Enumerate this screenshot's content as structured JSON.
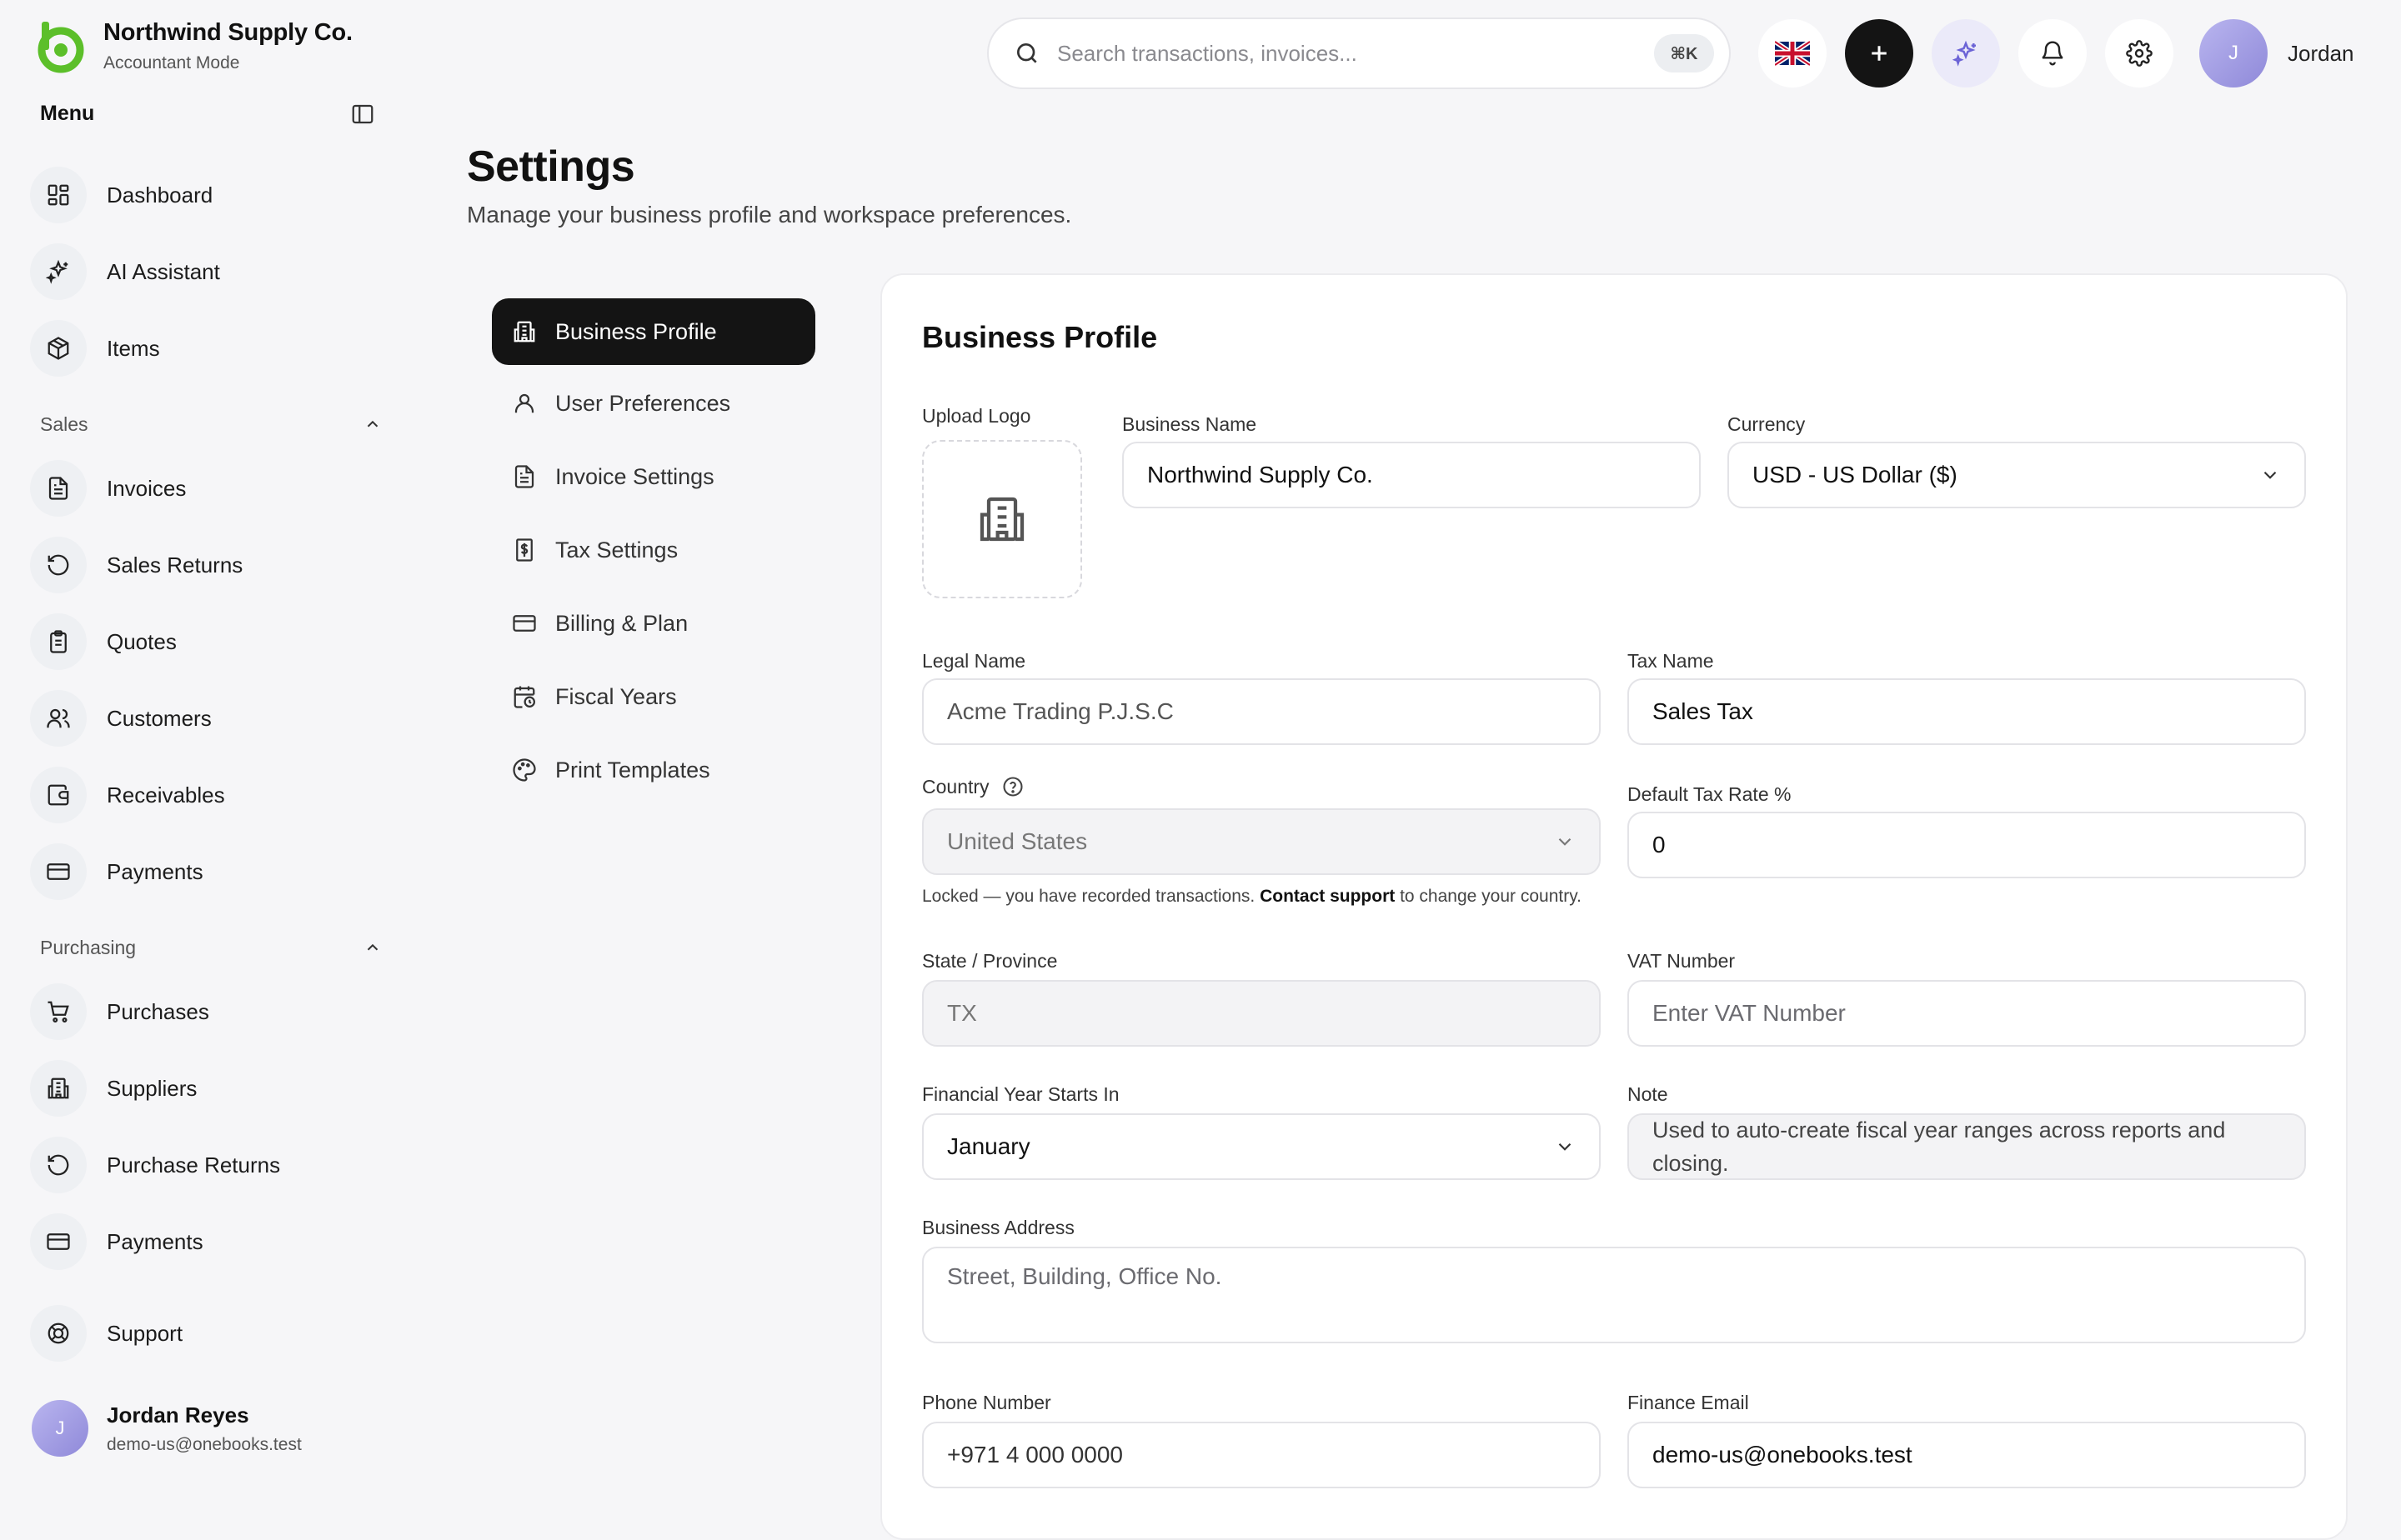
{
  "brand": {
    "name": "Northwind Supply Co.",
    "mode": "Accountant Mode"
  },
  "sidebar": {
    "menu_title": "Menu",
    "top_items": [
      {
        "label": "Dashboard",
        "icon": "dashboard-icon"
      },
      {
        "label": "AI Assistant",
        "icon": "sparkles-icon"
      },
      {
        "label": "Items",
        "icon": "package-icon"
      }
    ],
    "sales": {
      "label": "Sales",
      "expanded": true,
      "items": [
        {
          "label": "Invoices",
          "icon": "file-text-icon"
        },
        {
          "label": "Sales Returns",
          "icon": "rotate-ccw-icon"
        },
        {
          "label": "Quotes",
          "icon": "clipboard-icon"
        },
        {
          "label": "Customers",
          "icon": "users-icon"
        },
        {
          "label": "Receivables",
          "icon": "wallet-icon"
        },
        {
          "label": "Payments",
          "icon": "credit-card-icon"
        }
      ]
    },
    "purchasing": {
      "label": "Purchasing",
      "expanded": true,
      "items": [
        {
          "label": "Purchases",
          "icon": "cart-icon"
        },
        {
          "label": "Suppliers",
          "icon": "building-icon"
        },
        {
          "label": "Purchase Returns",
          "icon": "rotate-ccw-icon"
        },
        {
          "label": "Payments",
          "icon": "credit-card-icon"
        }
      ]
    },
    "support": {
      "label": "Support",
      "icon": "life-buoy-icon"
    },
    "user": {
      "initial": "J",
      "name": "Jordan Reyes",
      "email": "demo-us@onebooks.test"
    }
  },
  "topbar": {
    "search_placeholder": "Search transactions, invoices...",
    "shortcut": "⌘K",
    "user_initial": "J",
    "user_name": "Jordan"
  },
  "page": {
    "title": "Settings",
    "subtitle": "Manage your business profile and workspace preferences."
  },
  "settings_nav": [
    {
      "label": "Business Profile",
      "icon": "building-icon",
      "active": true
    },
    {
      "label": "User Preferences",
      "icon": "user-icon",
      "active": false
    },
    {
      "label": "Invoice Settings",
      "icon": "file-text-icon",
      "active": false
    },
    {
      "label": "Tax Settings",
      "icon": "dollar-receipt-icon",
      "active": false
    },
    {
      "label": "Billing & Plan",
      "icon": "credit-card-icon",
      "active": false
    },
    {
      "label": "Fiscal Years",
      "icon": "calendar-clock-icon",
      "active": false
    },
    {
      "label": "Print Templates",
      "icon": "palette-icon",
      "active": false
    }
  ],
  "form": {
    "title": "Business Profile",
    "upload_logo_label": "Upload Logo",
    "business_name": {
      "label": "Business Name",
      "value": "Northwind Supply Co."
    },
    "currency": {
      "label": "Currency",
      "value": "USD - US Dollar ($)"
    },
    "legal_name": {
      "label": "Legal Name",
      "value": "Acme Trading P.J.S.C"
    },
    "tax_name": {
      "label": "Tax Name",
      "value": "Sales Tax"
    },
    "country": {
      "label": "Country",
      "value": "United States",
      "hint_before": "Locked — you have recorded transactions.",
      "hint_link": "Contact support",
      "hint_after": "to change your country."
    },
    "default_tax_rate": {
      "label": "Default Tax Rate %",
      "value": "0"
    },
    "state": {
      "label": "State / Province",
      "value": "TX"
    },
    "vat_number": {
      "label": "VAT Number",
      "placeholder": "Enter VAT Number"
    },
    "financial_year": {
      "label": "Financial Year Starts In",
      "value": "January"
    },
    "note": {
      "label": "Note",
      "value": "Used to auto-create fiscal year ranges across reports and closing."
    },
    "business_address": {
      "label": "Business Address",
      "placeholder": "Street, Building, Office No."
    },
    "phone": {
      "label": "Phone Number",
      "value": "+971 4 000 0000"
    },
    "finance_email": {
      "label": "Finance Email",
      "value": "demo-us@onebooks.test"
    }
  },
  "colors": {
    "brand_green": "#5cbf2a",
    "active_nav": "#141414",
    "ai_accent": "#6b63d6"
  }
}
